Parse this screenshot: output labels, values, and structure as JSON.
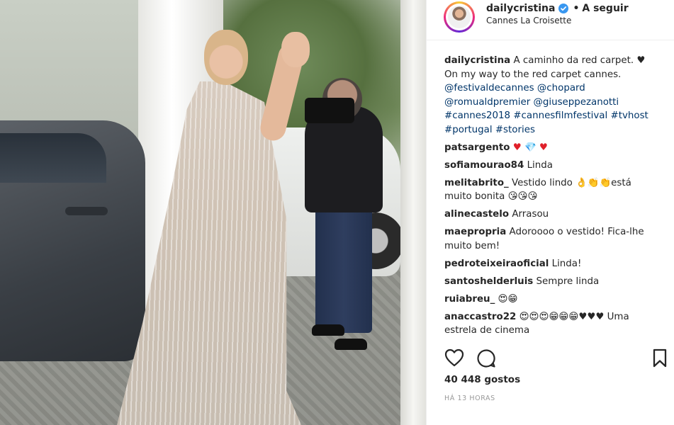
{
  "header": {
    "username": "dailycristina",
    "follow_separator": "•",
    "follow_label": "A seguir",
    "location": "Cannes La Croisette"
  },
  "caption": {
    "user": "dailycristina",
    "line1": "A caminho da red carpet.",
    "line1_emoji": "♥",
    "line2": "On my way to the red carpet cannes.",
    "line3": "@festivaldecannes @chopard",
    "line4": "@romualdpremier @giuseppezanotti",
    "line5": "#cannes2018 #cannesfilmfestival #tvhost",
    "line6": "#portugal #stories"
  },
  "comments": [
    {
      "user": "patsargento",
      "text": "",
      "emojis": "♥ 💎 ♥"
    },
    {
      "user": "sofiamourao84",
      "text": "Linda",
      "emojis": ""
    },
    {
      "user": "melitabrito_",
      "text": "Vestido lindo 👌👏👏está muito bonita 😘😘😘",
      "emojis": ""
    },
    {
      "user": "alinecastelo",
      "text": "Arrasou",
      "emojis": ""
    },
    {
      "user": "maepropria",
      "text": "Adoroooo o vestido! Fica-lhe muito bem!",
      "emojis": ""
    },
    {
      "user": "pedroteixeiraoficial",
      "text": "Linda!",
      "emojis": ""
    },
    {
      "user": "santoshelderluis",
      "text": "Sempre linda",
      "emojis": ""
    },
    {
      "user": "ruiabreu_",
      "text": "😍😁",
      "emojis": ""
    },
    {
      "user": "anaccastro22",
      "text": "😍😍😍😁😁😁♥♥♥ Uma estrela de cinema",
      "emojis": ""
    }
  ],
  "actions": {
    "like_icon": "heart-outline-icon",
    "comment_icon": "comment-bubble-icon",
    "save_icon": "bookmark-icon"
  },
  "likes_label": "40 448 gostos",
  "timestamp": "HÁ 13 HORAS",
  "colors": {
    "link": "#003569",
    "text": "#262626",
    "muted": "#999999",
    "verified": "#3897f0",
    "heart": "#e0202a"
  }
}
